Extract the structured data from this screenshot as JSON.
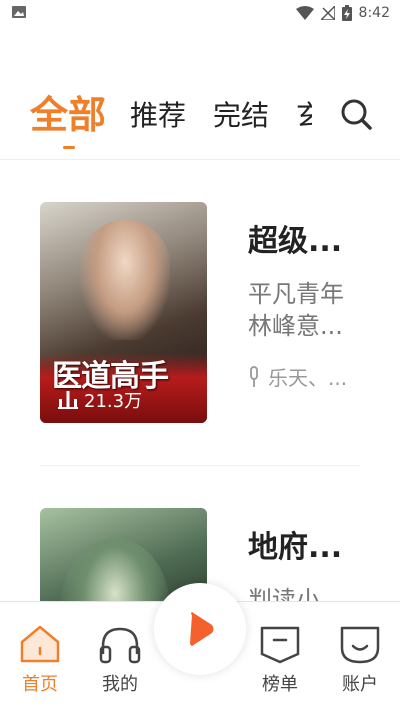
{
  "status_bar": {
    "time": "8:42"
  },
  "tabs": {
    "active": "全部",
    "items": [
      "推荐",
      "完结",
      "玄"
    ]
  },
  "books": [
    {
      "title": "超级...",
      "cover_title": "医道高手",
      "description": "平凡青年林峰意...",
      "author": "乐天、...",
      "listen_count": "21.3万"
    },
    {
      "title": "地府...",
      "description": "判读小子..."
    }
  ],
  "bottom_nav": {
    "home": "首页",
    "mine": "我的",
    "rank": "榜单",
    "account": "账户"
  },
  "colors": {
    "accent": "#f07f2a",
    "player": "#f5612c"
  }
}
